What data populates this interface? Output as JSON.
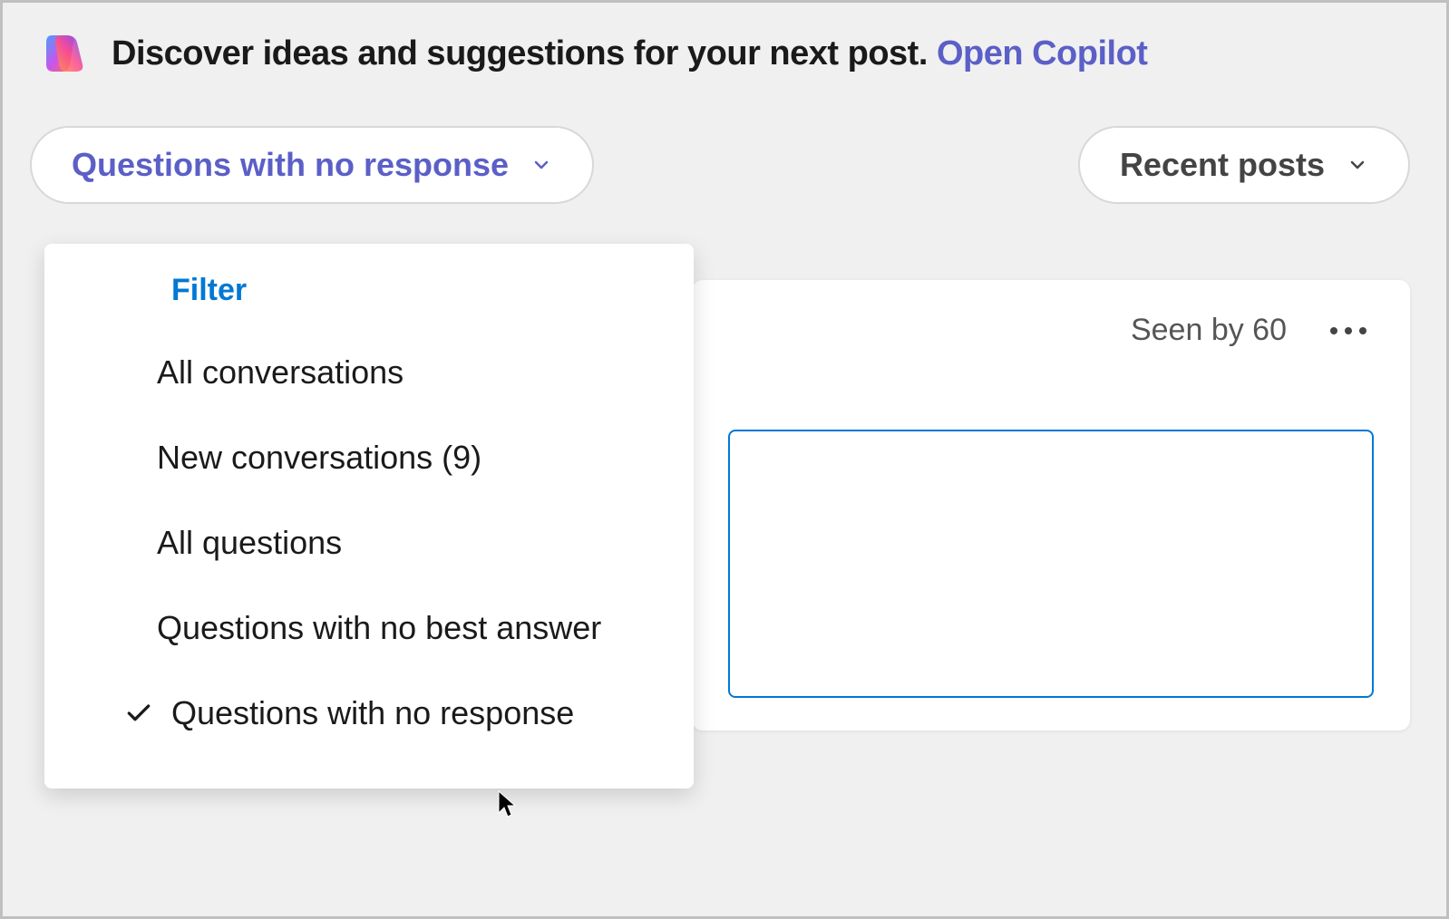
{
  "banner": {
    "text": "Discover ideas and suggestions for your next post. ",
    "link_text": "Open Copilot"
  },
  "filter_dropdown": {
    "selected_label": "Questions with no response",
    "header": "Filter",
    "options": [
      {
        "label": "All conversations",
        "selected": false
      },
      {
        "label": "New conversations (9)",
        "selected": false
      },
      {
        "label": "All questions",
        "selected": false
      },
      {
        "label": "Questions with no best answer",
        "selected": false
      },
      {
        "label": "Questions with no response",
        "selected": true
      }
    ]
  },
  "sort_dropdown": {
    "selected_label": "Recent posts"
  },
  "post": {
    "seen_by_label": "Seen by 60"
  }
}
